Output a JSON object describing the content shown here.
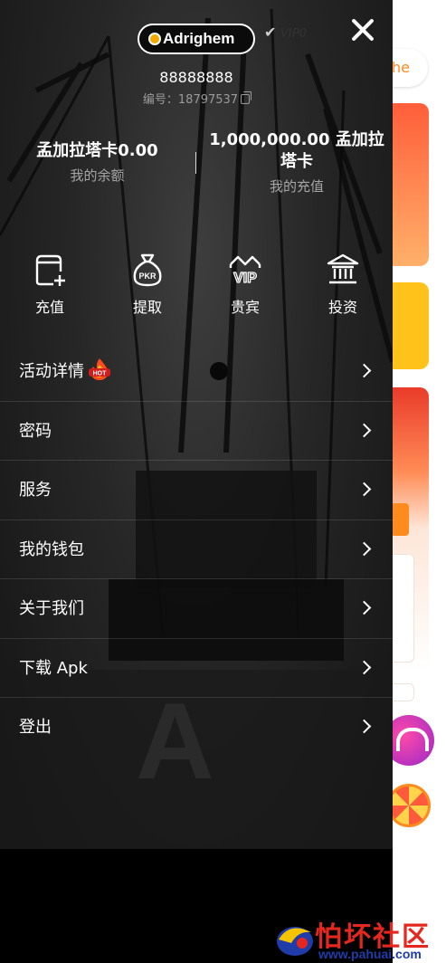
{
  "background_app": {
    "pill_label": "he"
  },
  "drawer": {
    "logo_text": "Adrighem",
    "vip_label": "VIP0",
    "username": "88888888",
    "user_id_label": "编号：18797537",
    "balance": {
      "value": "孟加拉塔卡0.00",
      "label": "我的余额"
    },
    "recharge": {
      "value": "1,000,000.00 孟加拉塔卡",
      "label": "我的充值"
    },
    "actions": [
      {
        "label": "充值",
        "icon": "wallet-add-icon"
      },
      {
        "label": "提取",
        "icon": "pkr-bag-icon"
      },
      {
        "label": "贵宾",
        "icon": "vip-crown-icon"
      },
      {
        "label": "投资",
        "icon": "bank-icon"
      }
    ],
    "menu": [
      {
        "label": "活动详情",
        "badge_icon": "hot-fire-icon"
      },
      {
        "label": "密码"
      },
      {
        "label": "服务"
      },
      {
        "label": "我的钱包"
      },
      {
        "label": "关于我们"
      },
      {
        "label": "下载 Apk"
      },
      {
        "label": "登出"
      }
    ]
  },
  "watermark": {
    "text": "怕坏社区",
    "url": "www.pahuai.com"
  },
  "colors": {
    "drawer_bg": "#000000",
    "logo_accent": "#f2a900",
    "brand_orange": "#ff8a1e",
    "watermark_red": "#e4281f"
  }
}
